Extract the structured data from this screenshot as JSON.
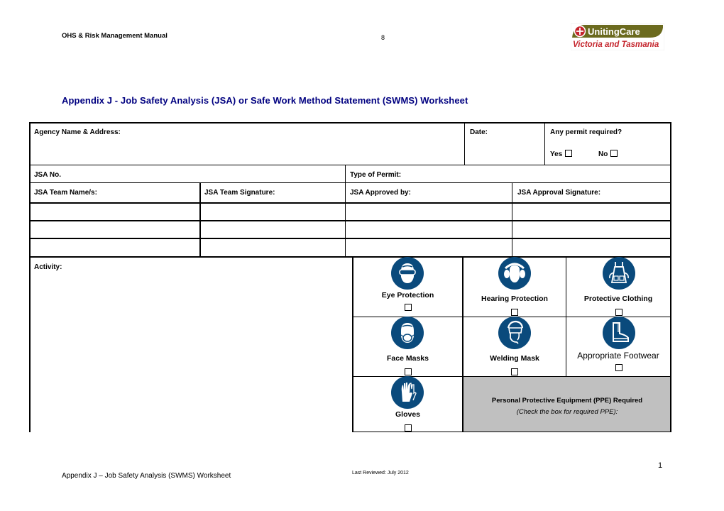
{
  "header": {
    "manual_title": "OHS & Risk Management Manual",
    "page_ref": "8",
    "logo": {
      "name": "UnitingCare",
      "sub": "Victoria and Tasmania",
      "colors": {
        "olive": "#6b6a1e",
        "red": "#c4232b"
      }
    }
  },
  "document_title": "Appendix J - Job Safety Analysis (JSA) or Safe Work Method Statement (SWMS) Worksheet",
  "form": {
    "agency_label": "Agency Name & Address:",
    "date_label": "Date:",
    "permit_question": "Any permit required?",
    "permit_yes": "Yes",
    "permit_no": "No",
    "jsa_no_label": "JSA No.",
    "type_of_permit_label": "Type of Permit:",
    "team_columns": [
      "JSA Team Name/s:",
      "JSA Team Signature:",
      "JSA Approved by:",
      "JSA Approval Signature:"
    ],
    "team_rows": [
      [
        "",
        "",
        "",
        ""
      ],
      [
        "",
        "",
        "",
        ""
      ],
      [
        "",
        "",
        "",
        ""
      ]
    ],
    "activity_label": "Activity:"
  },
  "ppe": {
    "items": [
      {
        "label": "Eye Protection",
        "icon": "safety-goggles-icon",
        "checked": false
      },
      {
        "label": "Hearing Protection",
        "icon": "ear-defenders-icon",
        "checked": false
      },
      {
        "label": "Protective Clothing",
        "icon": "apron-icon",
        "checked": false
      },
      {
        "label": "Face Masks",
        "icon": "respirator-mask-icon",
        "checked": false
      },
      {
        "label": "Welding Mask",
        "icon": "welding-shield-icon",
        "checked": false
      },
      {
        "label": "Appropriate Footwear",
        "icon": "safety-boot-icon",
        "checked": false
      },
      {
        "label": "Gloves",
        "icon": "gloves-icon",
        "checked": false
      }
    ],
    "required_title": "Personal Protective Equipment (PPE) Required",
    "required_sub": "(Check the box for required PPE):",
    "icon_color": "#0a4a7c",
    "panel_color": "#c0c0c0"
  },
  "footer": {
    "left": "Appendix J – Job Safety Analysis (SWMS) Worksheet",
    "reviewed": "Last Reviewed: July 2012",
    "page_number": "1"
  }
}
